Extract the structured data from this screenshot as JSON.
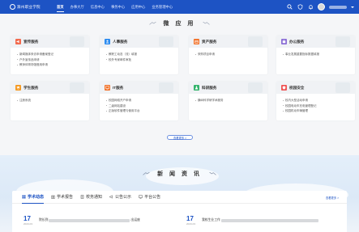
{
  "nav": {
    "logo_text": "滁州职业学院",
    "items": [
      "首页",
      "办事大厅",
      "信息中心",
      "事务中心",
      "应用中心",
      "业务管理中心"
    ]
  },
  "apps": {
    "title": "微 应 用",
    "cards": [
      {
        "title": "宣传服务",
        "icon": "megaphone-icon",
        "color": "#f26b4f",
        "items": [
          "新闻媒体采访申请备案登记",
          "户外宣传品申请",
          "教师体育场馆借用申请"
        ]
      },
      {
        "title": "人事服务",
        "icon": "person-icon",
        "color": "#2d8cf0",
        "items": [
          "教职工动态（流）填报",
          "校外专家邮件审批"
        ]
      },
      {
        "title": "资产服务",
        "icon": "box-icon",
        "color": "#f2732c",
        "items": [
          "采购项目申请"
        ]
      },
      {
        "title": "办公服务",
        "icon": "briefcase-icon",
        "color": "#8b6fd6",
        "items": [
          "事业发展重要指标数据填报"
        ]
      },
      {
        "title": "学生服务",
        "icon": "student-icon",
        "color": "#f59a23",
        "items": [
          "注册系统"
        ]
      },
      {
        "title": "IT服务",
        "icon": "monitor-icon",
        "color": "#f2732c",
        "items": [
          "校园网络开户申请",
          "二级网站建设",
          "正版软件管理与使用平台"
        ]
      },
      {
        "title": "科研服务",
        "icon": "flask-icon",
        "color": "#33b36b",
        "items": [
          "横纵科学研学术服务"
        ]
      },
      {
        "title": "校园安全",
        "icon": "shield-icon",
        "color": "#ef5656",
        "items": [
          "校内大型活动申请",
          "校园电动车充电管理登记",
          "校园机动车辆管理"
        ]
      }
    ],
    "more_label": "查看更多 >"
  },
  "news": {
    "title": "新 闻 资 讯",
    "tabs": [
      "学术动态",
      "学术报告",
      "校务通知",
      "公告公示",
      "平台公告"
    ],
    "more_label": "查看更多 >",
    "items": [
      {
        "day": "17",
        "ym": "2023-03",
        "prefix": "院长到",
        "suffix": "出运座"
      },
      {
        "day": "17",
        "ym": "2023-03",
        "prefix": "我校生业工作",
        "suffix": ""
      }
    ]
  },
  "colors": {
    "primary": "#1d53c4"
  }
}
